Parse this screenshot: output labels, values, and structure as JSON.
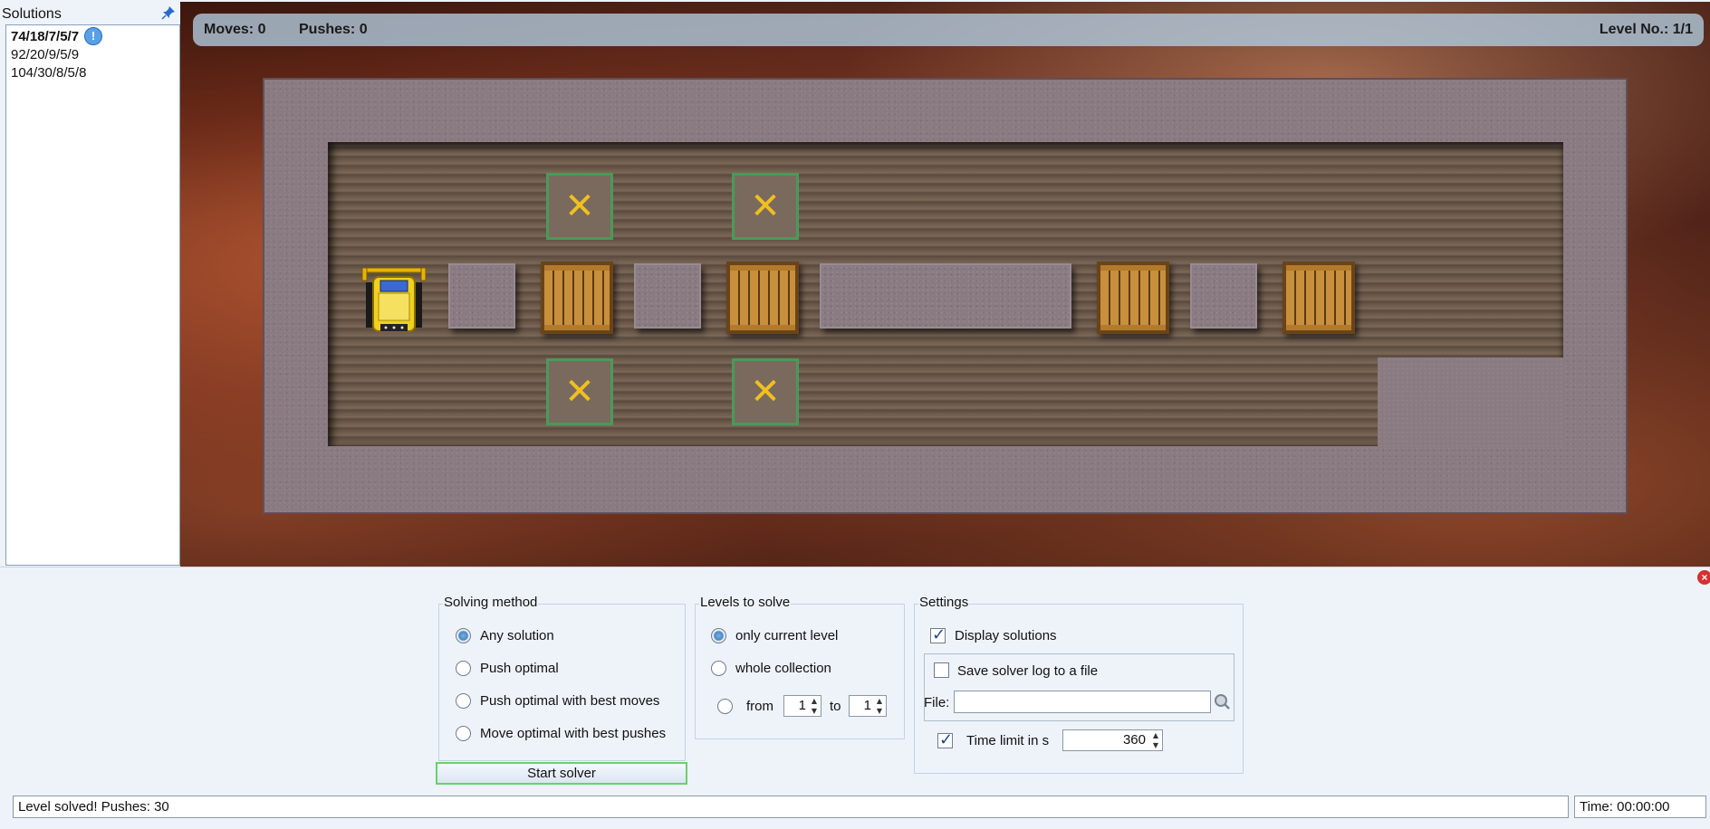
{
  "solutions_panel": {
    "title": "Solutions",
    "items": [
      {
        "label": "74/18/7/5/7",
        "bold": true
      },
      {
        "label": "92/20/9/5/9",
        "bold": false
      },
      {
        "label": "104/30/8/5/8",
        "bold": false
      }
    ],
    "info_badge": "!"
  },
  "hud": {
    "moves": "Moves: 0",
    "pushes": "Pushes: 0",
    "level": "Level No.: 1/1"
  },
  "board": {
    "goal_mark": "✕",
    "crate_count": 4,
    "goal_count": 4
  },
  "solver": {
    "solving_method": {
      "title": "Solving method",
      "options": [
        "Any solution",
        "Push optimal",
        "Push optimal with best moves",
        "Move optimal with best pushes"
      ],
      "selected": "Any solution"
    },
    "levels_to_solve": {
      "title": "Levels to solve",
      "options": [
        "only current level",
        "whole collection"
      ],
      "selected": "only current level",
      "from_label": "from",
      "to_label": "to",
      "from_value": "1",
      "to_value": "1"
    },
    "settings": {
      "title": "Settings",
      "display_solutions": "Display solutions",
      "display_solutions_checked": true,
      "save_log": "Save solver log to a file",
      "save_log_checked": false,
      "file_label": "File:",
      "file_value": "",
      "time_limit": "Time limit in s",
      "time_limit_checked": true,
      "time_limit_value": "360"
    },
    "start_button": "Start solver"
  },
  "status": {
    "message": "Level solved! Pushes: 30",
    "time": "Time: 00:00:00"
  },
  "colors": {
    "panel_bg": "#eef3fa",
    "goal_border": "#4a9a58",
    "goal_mark": "#f0c020",
    "start_button_border": "#6bd06b"
  }
}
